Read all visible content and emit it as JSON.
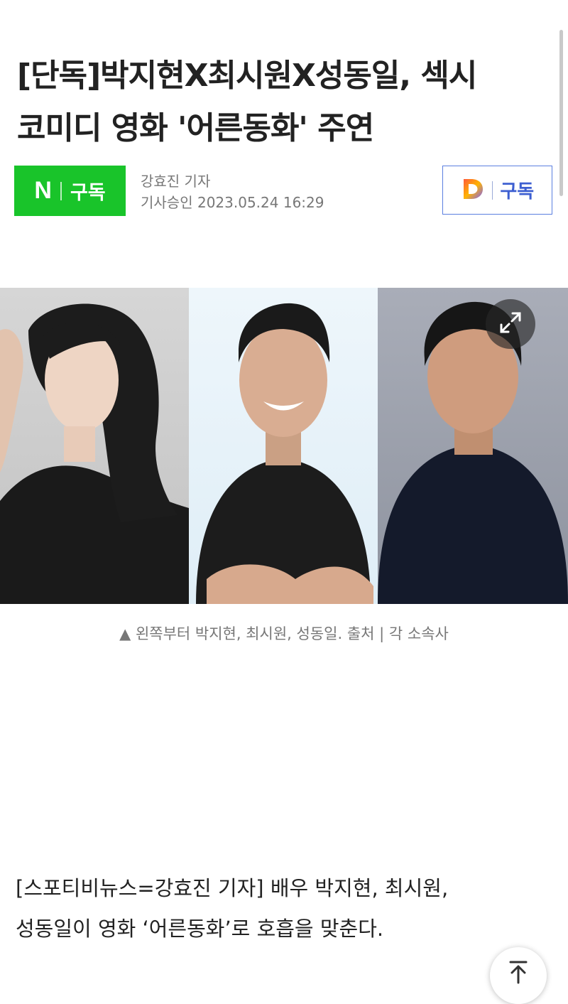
{
  "article": {
    "title_line1": "[단독]박지현X최시원X성동일, 섹시",
    "title_line2": "코미디 영화 '어른동화' 주연",
    "reporter": "강효진 기자",
    "approved_label": "기사승인",
    "approved_datetime": "2023.05.24 16:29",
    "photo_caption": "▲ 왼쪽부터 박지현, 최시원, 성동일. 출처 | 각 소속사",
    "body_line1": "[스포티비뉴스=강효진 기자] 배우 박지현, 최시원,",
    "body_line2": "성동일이 영화 ‘어른동화’로 호흡을 맞춘다."
  },
  "naver_subscribe": {
    "logo": "N",
    "label": "구독",
    "color": "#19c42a"
  },
  "daum_subscribe": {
    "logo": "D",
    "label": "구독",
    "color": "#3d5fd1"
  },
  "icons": {
    "expand": "expand-icon",
    "scroll_top": "arrow-up-to-top-icon"
  }
}
